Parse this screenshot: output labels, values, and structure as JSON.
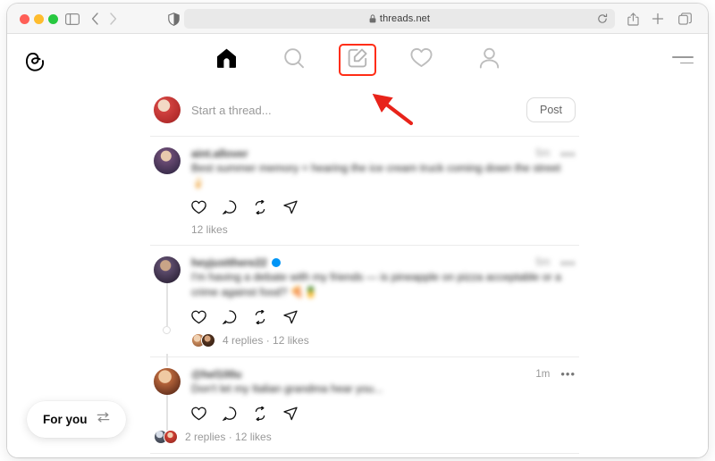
{
  "browser": {
    "url_text": "threads.net",
    "lock_icon": "lock-icon",
    "reload_icon": "reload-icon",
    "sidebar_icon": "sidebar-toggle-icon",
    "back_icon": "chevron-left-icon",
    "forward_icon": "chevron-right-icon",
    "reader_icon": "reader-privacy-icon",
    "share_icon": "share-icon",
    "newtab_icon": "plus-icon",
    "tabs_icon": "tab-overview-icon",
    "traffic_lights": [
      "close-red",
      "minimize-yellow",
      "zoom-green"
    ]
  },
  "nav": {
    "logo_icon": "threads-logo-icon",
    "items": [
      {
        "name": "home",
        "icon": "home-icon",
        "state": "active"
      },
      {
        "name": "search",
        "icon": "search-icon",
        "state": "inactive"
      },
      {
        "name": "compose",
        "icon": "compose-icon",
        "state": "highlighted"
      },
      {
        "name": "activity",
        "icon": "heart-icon",
        "state": "inactive"
      },
      {
        "name": "profile",
        "icon": "person-icon",
        "state": "inactive"
      }
    ],
    "menu_icon": "hamburger-menu-icon"
  },
  "composer": {
    "placeholder": "Start a thread...",
    "post_label": "Post",
    "avatar": "user-avatar"
  },
  "posts": [
    {
      "username": "aint.allover",
      "verified": false,
      "timestamp": "5m",
      "more_icon": "more-options-icon",
      "text": "Best summer memory = hearing the ice cream truck coming down the street 🍦",
      "stats": "12 likes",
      "reply_avatars": 0,
      "actions": [
        "like-icon",
        "reply-icon",
        "repost-icon",
        "share-icon"
      ]
    },
    {
      "username": "heyjustthere22",
      "verified": true,
      "timestamp": "5m",
      "more_icon": "more-options-icon",
      "text": "I'm having a debate with my friends — is pineapple on pizza acceptable or a crime against food? 🍕🍍",
      "stats": "4 replies · 12 likes",
      "reply_avatars": 2,
      "actions": [
        "like-icon",
        "reply-icon",
        "repost-icon",
        "share-icon"
      ]
    },
    {
      "username": "@hel100u",
      "verified": false,
      "timestamp": "1m",
      "more_icon": "more-options-icon",
      "text": "Don't let my Italian grandma hear you...",
      "stats": "2 replies · 12 likes",
      "reply_avatars": 2,
      "actions": [
        "like-icon",
        "reply-icon",
        "repost-icon",
        "share-icon"
      ]
    }
  ],
  "feed_switcher": {
    "label": "For you",
    "icon": "swap-arrows-icon"
  },
  "annotation": {
    "highlight_color": "#ff2d16",
    "arrow_color": "#e8231a",
    "target": "compose-button"
  }
}
